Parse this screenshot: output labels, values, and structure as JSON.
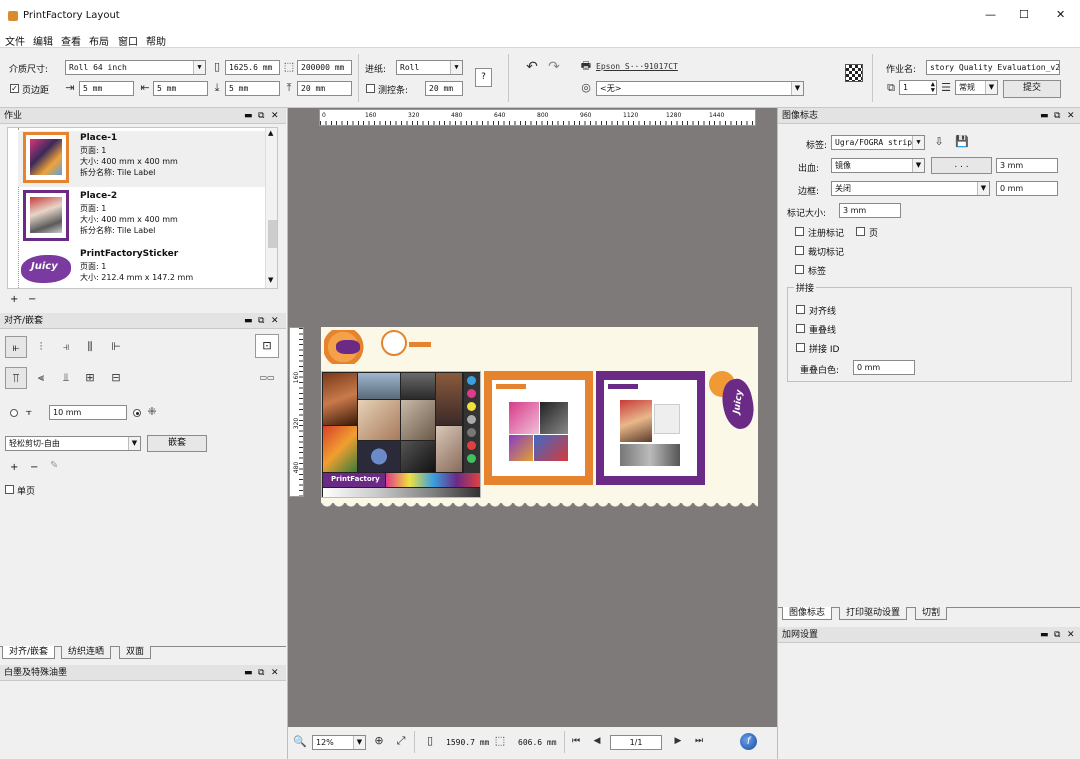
{
  "app": {
    "title": "PrintFactory Layout"
  },
  "window_controls": {
    "minimize": "—",
    "maximize": "☐",
    "close": "✕"
  },
  "menu": [
    "文件",
    "编辑",
    "查看",
    "布局",
    "窗口",
    "帮助"
  ],
  "toolbar": {
    "media_size_label": "介质尺寸:",
    "media_size_value": "Roll 64 inch",
    "width_value": "1625.6 mm",
    "length_value": "200000 mm",
    "feed_label": "进纸:",
    "feed_value": "Roll",
    "margin_label": "页边距",
    "margin_left": "5 mm",
    "margin_right": "5 mm",
    "margin_bottom": "5 mm",
    "margin_top": "20 mm",
    "test_strip_label": "测控条:",
    "test_strip_value": "20 mm",
    "help_symbol": "?",
    "printer_name": "Epson S···91017CT",
    "profile_value": "<无>",
    "job_name_label": "作业名:",
    "job_name_value": "story Quality Evaluation_v2",
    "copies_value": "1",
    "priority_value": "常规",
    "submit_label": "提交"
  },
  "jobs_panel": {
    "title": "作业",
    "items": [
      {
        "name": "Place-1",
        "pages": "页面: 1",
        "size": "大小: 400 mm x 400 mm",
        "split": "拆分名称:  Tile Label"
      },
      {
        "name": "Place-2",
        "pages": "页面: 1",
        "size": "大小: 400 mm x 400 mm",
        "split": "拆分名称:  Tile Label"
      },
      {
        "name": "PrintFactorySticker",
        "pages": "页面: 1",
        "size": "大小: 212.4 mm x 147.2 mm",
        "split": ""
      }
    ],
    "add": "+",
    "remove": "−"
  },
  "align_panel": {
    "title": "对齐/嵌套",
    "spacing_value": "10 mm",
    "nest_mode": "轻松剪切-自由",
    "nest_button": "嵌套",
    "add": "+",
    "remove": "−",
    "single_page": "单页",
    "tabs": [
      "对齐/嵌套",
      "纺织连晒",
      "双面"
    ]
  },
  "white_ink_panel": {
    "title": "白墨及特殊油墨"
  },
  "ruler": {
    "h_ticks": [
      "0",
      "160",
      "320",
      "480",
      "640",
      "800",
      "960",
      "1120",
      "1280",
      "1440"
    ],
    "v_ticks": [
      "160",
      "320",
      "480"
    ]
  },
  "canvas": {
    "label_juicy": "Juicy",
    "mini_label": "Juicy",
    "pf_label": "PrintFactory"
  },
  "status": {
    "zoom": "12%",
    "width": "1590.7 mm",
    "height": "606.6 mm",
    "page": "1/1"
  },
  "marks_panel": {
    "title": "图像标志",
    "label_label": "标签:",
    "label_value": "Ugra/FOGRA strip",
    "bleed_label": "出血:",
    "bleed_value": "镜像",
    "bleed_button": ". . .",
    "bleed_size": "3 mm",
    "border_label": "边框:",
    "border_value": "关闭",
    "border_size": "0 mm",
    "mark_size_label": "标记大小:",
    "mark_size_value": "3 mm",
    "reg_marks": "注册标记",
    "page": "页",
    "crop_marks": "裁切标记",
    "label_cb": "标签",
    "tiling_group": "拼接",
    "align_lines": "对齐线",
    "overlap_lines": "重叠线",
    "tile_id": "拼接 ID",
    "overlap_white_label": "重叠白色:",
    "overlap_white_value": "0 mm",
    "tabs": [
      "图像标志",
      "打印驱动设置",
      "切割"
    ]
  },
  "screening_panel": {
    "title": "加网设置"
  },
  "colors": {
    "canvas_bg": "#7e7a79",
    "orange": "#e6832f",
    "purple": "#6a2a86",
    "cream": "#fbf8e8"
  }
}
